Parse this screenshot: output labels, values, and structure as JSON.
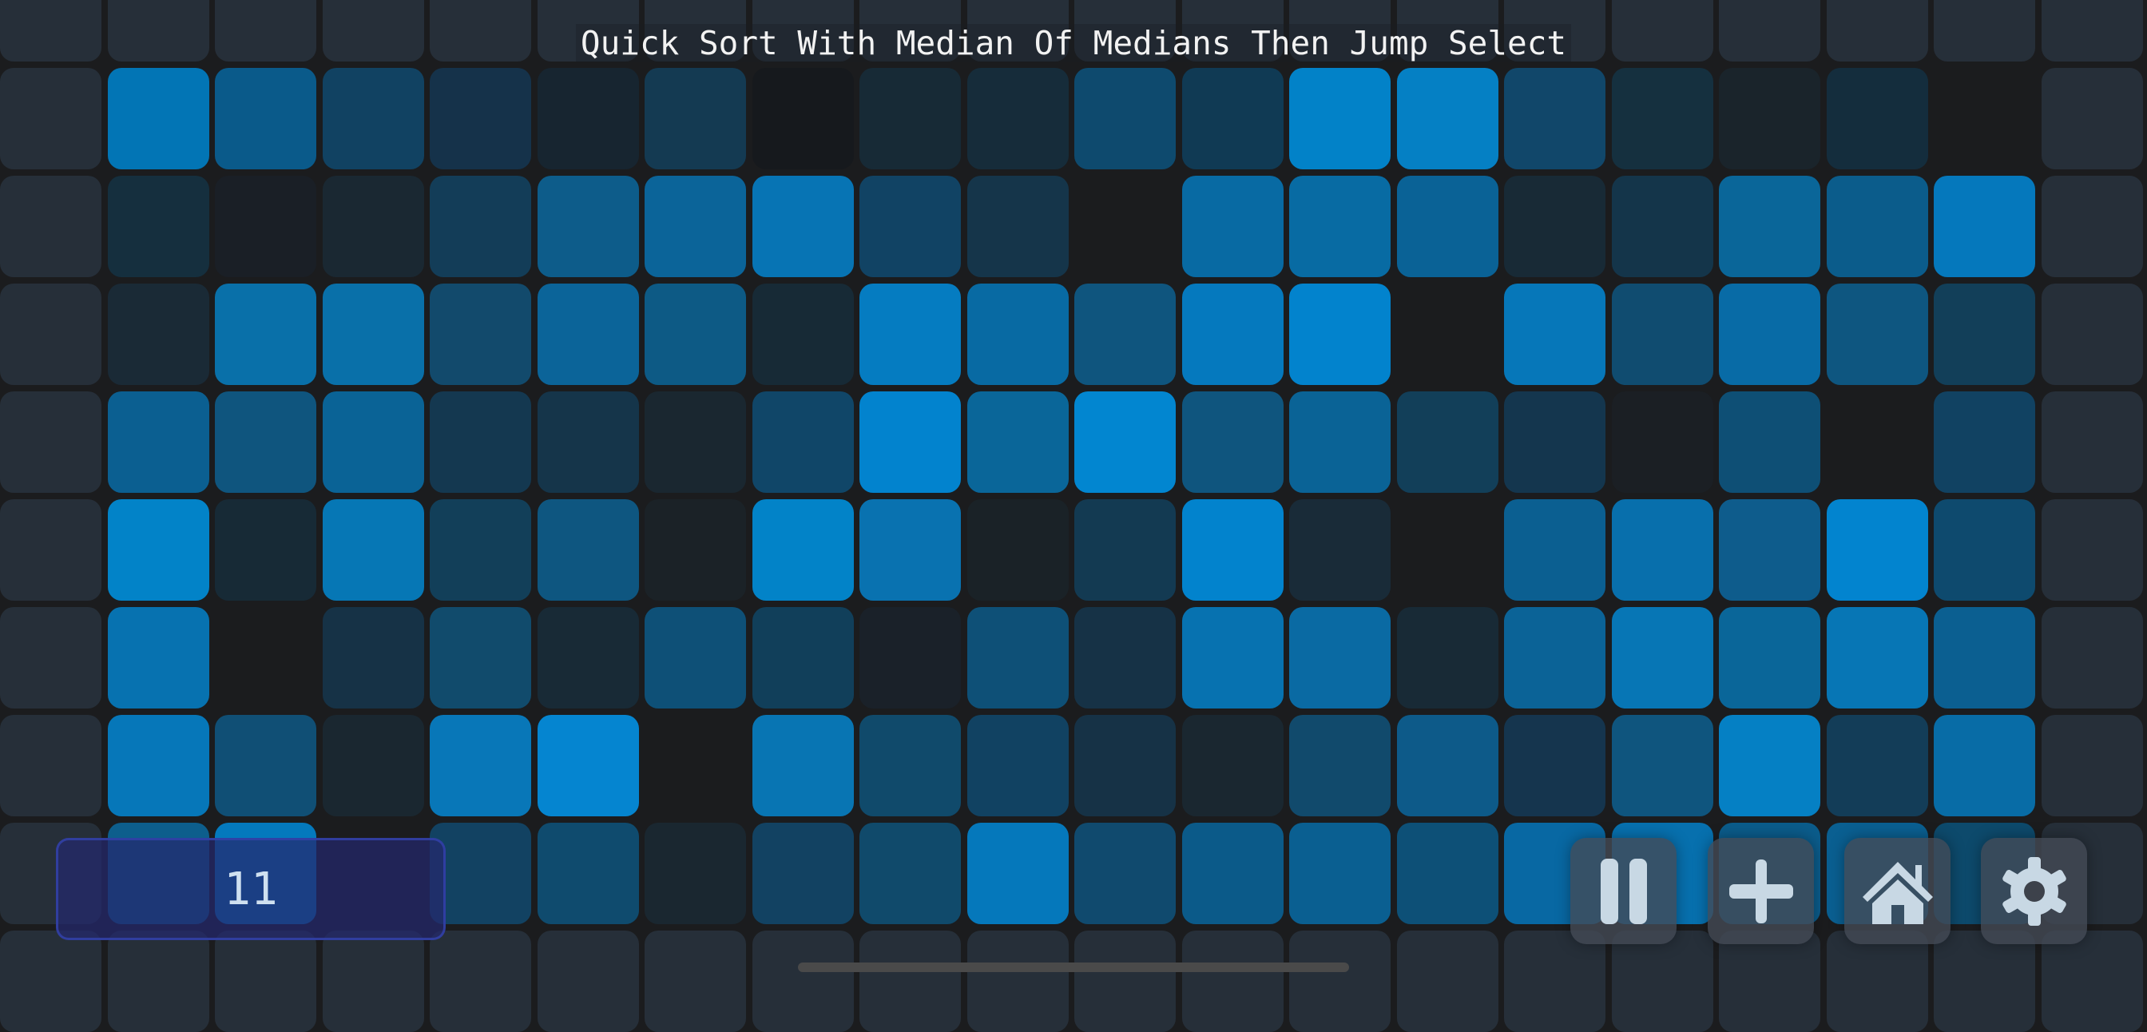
{
  "title": "Quick Sort With Median Of Medians Then Jump Select",
  "counter": "11",
  "buttons": {
    "pause": "pause-icon",
    "add": "plus-icon",
    "home": "home-icon",
    "settings": "gear-icon"
  },
  "colors": {
    "background": "#1b1c1e",
    "border_cell": "#262f39",
    "icon": "#c8d8e4"
  },
  "grid": {
    "columns": 20,
    "rows": 10,
    "inner": [
      [
        "#0275b5",
        "#0a5a8a",
        "#114262",
        "#15324a",
        "#172530",
        "#143a52",
        "#16191d",
        "#172a36",
        "#162c3a",
        "#0e4a6e",
        "#103a54",
        "#0282c8",
        "#0580c4",
        "#11476a",
        "#15303f",
        "#1a242b",
        "#142d3d",
        null
      ],
      [
        "#152f3e",
        "#1a1f26",
        "#1a2832",
        "#133d58",
        "#0d5c8a",
        "#0b6499",
        "#0774b4",
        "#114364",
        "#15354a",
        null,
        "#086aa3",
        "#086ba3",
        "#0a6296",
        "#182a36",
        "#14354a",
        "#0a6699",
        "#0b5c8b",
        "#0578bc"
      ],
      [
        "#1a2a36",
        "#0970a9",
        "#0970a9",
        "#124a6c",
        "#0b6499",
        "#0d5a85",
        "#172a36",
        "#057cc1",
        "#086aa3",
        "#0f557e",
        "#0579be",
        "#0283cd",
        null,
        "#0677b9",
        "#104c70",
        "#086ba6",
        "#0e5680",
        "#123f59"
      ],
      [
        "#0b5f91",
        "#0f557e",
        "#0a6396",
        "#143850",
        "#15354a",
        "#1a2730",
        "#104668",
        "#0283ce",
        "#0a6699",
        "#0286d0",
        "#0f557e",
        "#0a6396",
        "#123f59",
        "#14364e",
        "#1b1f24",
        "#0e4f75",
        null,
        "#114262"
      ],
      [
        "#0283c8",
        "#172a36",
        "#0677b5",
        "#123f59",
        "#0e5680",
        "#1b2227",
        "#0283c8",
        "#0972b0",
        "#1a2227",
        "#133a52",
        "#0283cd",
        "#192b38",
        null,
        "#0b5f91",
        "#086fac",
        "#0e5c8c",
        "#0284cf",
        "#0e4a6e"
      ],
      [
        "#0772b0",
        null,
        "#163246",
        "#114b6c",
        "#182a36",
        "#0e5077",
        "#113f5a",
        "#1a2129",
        "#0e5077",
        "#163246",
        "#0772b0",
        "#0a6aa3",
        "#182a36",
        "#0b6397",
        "#0776b5",
        "#0a6699",
        "#0776b5",
        "#0b5f91"
      ],
      [
        "#0677b9",
        "#104f75",
        "#1a2730",
        "#0877b8",
        "#0585d0",
        null,
        "#0875b3",
        "#104a6b",
        "#114262",
        "#163246",
        "#1a2730",
        "#114a6c",
        "#0d5a89",
        "#15354e",
        "#0f557e",
        "#0580c4",
        "#133d58",
        "#086ca6"
      ],
      [
        "#0d5e8c",
        "#0479bd",
        null,
        "#124262",
        "#0f4b6e",
        "#1a2730",
        "#124262",
        "#104a6b",
        "#0578bb",
        "#104a6e",
        "#0b5a89",
        "#0a5f91",
        "#0d5077",
        "#0868a3",
        "#0770ae",
        "#0b5c8b",
        "#0a5f91",
        "#0d4a6c"
      ]
    ]
  }
}
